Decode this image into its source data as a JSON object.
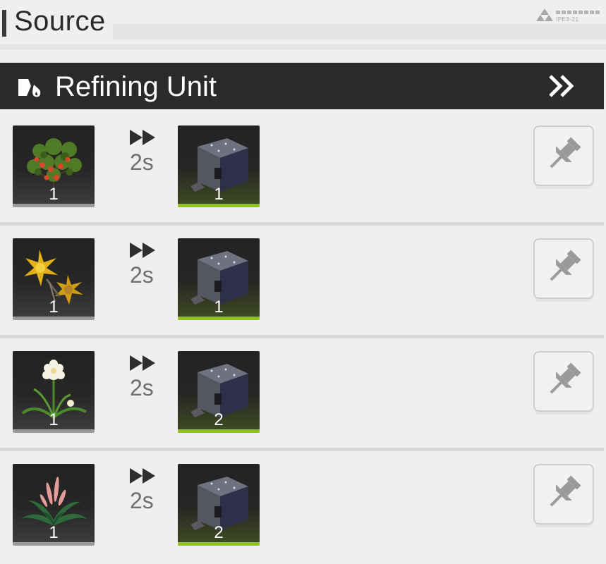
{
  "header": {
    "title": "Source",
    "corner_code": "IPE3-21"
  },
  "section": {
    "title": "Refining Unit",
    "forward_icon": "double-chevron-right-icon"
  },
  "recipes": [
    {
      "input": {
        "name": "red-berry-shrub",
        "qty": "1"
      },
      "time": "2s",
      "output": {
        "name": "ore-block",
        "qty": "1"
      }
    },
    {
      "input": {
        "name": "yellow-flower",
        "qty": "1"
      },
      "time": "2s",
      "output": {
        "name": "ore-block",
        "qty": "1"
      }
    },
    {
      "input": {
        "name": "white-flower",
        "qty": "1"
      },
      "time": "2s",
      "output": {
        "name": "ore-block",
        "qty": "2"
      }
    },
    {
      "input": {
        "name": "pink-leafy-plant",
        "qty": "1"
      },
      "time": "2s",
      "output": {
        "name": "ore-block",
        "qty": "2"
      }
    }
  ],
  "colors": {
    "output_bar": "#8fc02a",
    "input_bar": "#9a9a9a",
    "header_bg": "#2a2a2a"
  }
}
